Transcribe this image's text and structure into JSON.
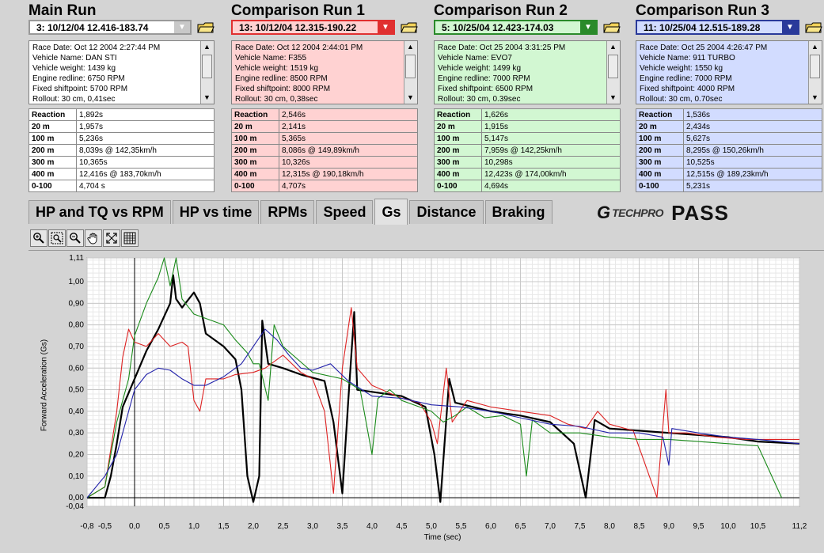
{
  "runs": [
    {
      "title": "Main Run",
      "selector": "3:  10/12/04 12.416-183.74",
      "color": "#ffffff",
      "btn": "#c8c8c8",
      "info": [
        "Race Date: Oct 12 2004  2:27:44 PM",
        "Vehicle Name: DAN STI",
        "Vehicle weight: 1439 kg",
        "Engine redline: 6750 RPM",
        "Fixed shiftpoint: 5700 RPM",
        "Rollout: 30 cm, 0,41sec"
      ],
      "stats": [
        [
          "Reaction",
          "1,892s"
        ],
        [
          "20 m",
          "1,957s"
        ],
        [
          "100 m",
          "5,236s"
        ],
        [
          "200 m",
          "8,039s @ 142,35km/h"
        ],
        [
          "300 m",
          "10,365s"
        ],
        [
          "400 m",
          "12,416s @ 183,70km/h"
        ],
        [
          "0-100",
          "4,704 s"
        ]
      ]
    },
    {
      "title": "Comparison Run 1",
      "selector": "13:  10/12/04 12.315-190.22",
      "color": "#ffd2d2",
      "btn": "#e03030",
      "info": [
        "Race Date: Oct 12 2004  2:44:01 PM",
        "Vehicle Name: F355",
        "Vehicle weight: 1519 kg",
        "Engine redline: 8500 RPM",
        "Fixed shiftpoint: 8000 RPM",
        "Rollout: 30 cm, 0,38sec"
      ],
      "stats": [
        [
          "Reaction",
          "2,546s"
        ],
        [
          "20 m",
          "2,141s"
        ],
        [
          "100 m",
          "5,365s"
        ],
        [
          "200 m",
          "8,086s @ 149,89km/h"
        ],
        [
          "300 m",
          "10,326s"
        ],
        [
          "400 m",
          "12,315s @ 190,18km/h"
        ],
        [
          "0-100",
          "4,707s"
        ]
      ]
    },
    {
      "title": "Comparison Run 2",
      "selector": "5:  10/25/04 12.423-174.03",
      "color": "#d2f7d2",
      "btn": "#2a8a2a",
      "info": [
        "Race Date: Oct 25 2004  3:31:25 PM",
        "Vehicle Name: EVO7",
        "Vehicle weight: 1499 kg",
        "Engine redline: 7000 RPM",
        "Fixed shiftpoint: 6500 RPM",
        "Rollout: 30 cm, 0.39sec"
      ],
      "stats": [
        [
          "Reaction",
          "1,626s"
        ],
        [
          "20 m",
          "1,915s"
        ],
        [
          "100 m",
          "5,147s"
        ],
        [
          "200 m",
          "7,959s @ 142,25km/h"
        ],
        [
          "300 m",
          "10,298s"
        ],
        [
          "400 m",
          "12,423s @ 174,00km/h"
        ],
        [
          "0-100",
          "4,694s"
        ]
      ]
    },
    {
      "title": "Comparison Run 3",
      "selector": "11:  10/25/04 12.515-189.28",
      "color": "#d2dcff",
      "btn": "#2a3a9a",
      "info": [
        "Race Date: Oct 25 2004  4:26:47 PM",
        "Vehicle Name: 911 TURBO",
        "Vehicle weight: 1550 kg",
        "Engine redline: 7000 RPM",
        "Fixed shiftpoint: 4000 RPM",
        "Rollout: 30 cm, 0.70sec"
      ],
      "stats": [
        [
          "Reaction",
          "1,536s"
        ],
        [
          "20 m",
          "2,434s"
        ],
        [
          "100 m",
          "5,627s"
        ],
        [
          "200 m",
          "8,295s @ 150,26km/h"
        ],
        [
          "300 m",
          "10,525s"
        ],
        [
          "400 m",
          "12,515s @ 189,23km/h"
        ],
        [
          "0-100",
          "5,231s"
        ]
      ]
    }
  ],
  "tabs": [
    "HP and TQ vs RPM",
    "HP vs time",
    "RPMs",
    "Speed",
    "Gs",
    "Distance",
    "Braking"
  ],
  "active_tab": "Gs",
  "logo": {
    "g": "G",
    "tech": "TECHPRO",
    "pass": "PASS"
  },
  "tools": [
    "zoom-in-icon",
    "zoom-box-icon",
    "zoom-out-icon",
    "pan-hand-icon",
    "fit-icon",
    "grid-icon"
  ],
  "chart": {
    "ylabel": "Forward Acceleration (Gs)",
    "xlabel": "Time (sec)",
    "xlim": [
      -0.8,
      11.2
    ],
    "ylim": [
      -0.04,
      1.11
    ],
    "xticks": [
      "-0,8",
      "-0,5",
      "0,0",
      "0,5",
      "1,0",
      "1,5",
      "2,0",
      "2,5",
      "3,0",
      "3,5",
      "4,0",
      "4,5",
      "5,0",
      "5,5",
      "6,0",
      "6,5",
      "7,0",
      "7,5",
      "8,0",
      "8,5",
      "9,0",
      "9,5",
      "10,0",
      "10,5",
      "11,2"
    ],
    "xtick_vals": [
      -0.8,
      -0.5,
      0,
      0.5,
      1,
      1.5,
      2,
      2.5,
      3,
      3.5,
      4,
      4.5,
      5,
      5.5,
      6,
      6.5,
      7,
      7.5,
      8,
      8.5,
      9,
      9.5,
      10,
      10.5,
      11.2
    ],
    "yticks": [
      "-0,04",
      "0,00",
      "0,10",
      "0,20",
      "0,30",
      "0,40",
      "0,50",
      "0,60",
      "0,70",
      "0,80",
      "0,90",
      "1,00",
      "1,11"
    ],
    "ytick_vals": [
      -0.04,
      0,
      0.1,
      0.2,
      0.3,
      0.4,
      0.5,
      0.6,
      0.7,
      0.8,
      0.9,
      1.0,
      1.11
    ]
  },
  "chart_data": {
    "type": "line",
    "x_unit": "sec",
    "y_unit": "Gs",
    "series": [
      {
        "name": "Main Run",
        "color": "#000000",
        "points": [
          [
            -0.8,
            0
          ],
          [
            -0.5,
            0
          ],
          [
            -0.4,
            0.1
          ],
          [
            -0.3,
            0.25
          ],
          [
            -0.2,
            0.42
          ],
          [
            0,
            0.55
          ],
          [
            0.2,
            0.68
          ],
          [
            0.4,
            0.78
          ],
          [
            0.6,
            0.9
          ],
          [
            0.65,
            1.03
          ],
          [
            0.7,
            0.92
          ],
          [
            0.8,
            0.88
          ],
          [
            1.0,
            0.95
          ],
          [
            1.1,
            0.9
          ],
          [
            1.2,
            0.76
          ],
          [
            1.5,
            0.7
          ],
          [
            1.7,
            0.64
          ],
          [
            1.8,
            0.5
          ],
          [
            1.9,
            0.1
          ],
          [
            2.0,
            -0.02
          ],
          [
            2.1,
            0.1
          ],
          [
            2.15,
            0.82
          ],
          [
            2.25,
            0.62
          ],
          [
            2.5,
            0.6
          ],
          [
            2.8,
            0.57
          ],
          [
            3.2,
            0.54
          ],
          [
            3.35,
            0.35
          ],
          [
            3.5,
            0.02
          ],
          [
            3.6,
            0.45
          ],
          [
            3.7,
            0.86
          ],
          [
            3.75,
            0.5
          ],
          [
            4.0,
            0.49
          ],
          [
            4.5,
            0.47
          ],
          [
            4.9,
            0.42
          ],
          [
            5.05,
            0.2
          ],
          [
            5.15,
            -0.02
          ],
          [
            5.3,
            0.55
          ],
          [
            5.4,
            0.44
          ],
          [
            6.0,
            0.4
          ],
          [
            6.5,
            0.38
          ],
          [
            7.0,
            0.35
          ],
          [
            7.4,
            0.25
          ],
          [
            7.6,
            0.0
          ],
          [
            7.75,
            0.36
          ],
          [
            8.0,
            0.32
          ],
          [
            8.5,
            0.31
          ],
          [
            9.0,
            0.3
          ],
          [
            9.5,
            0.29
          ],
          [
            10.0,
            0.28
          ],
          [
            10.5,
            0.26
          ],
          [
            11.2,
            0.25
          ]
        ]
      },
      {
        "name": "Comparison Run 1",
        "color": "#dd2222",
        "points": [
          [
            -0.8,
            0
          ],
          [
            -0.5,
            0.05
          ],
          [
            -0.3,
            0.4
          ],
          [
            -0.2,
            0.65
          ],
          [
            -0.1,
            0.78
          ],
          [
            0,
            0.72
          ],
          [
            0.2,
            0.7
          ],
          [
            0.4,
            0.76
          ],
          [
            0.6,
            0.7
          ],
          [
            0.8,
            0.72
          ],
          [
            0.9,
            0.7
          ],
          [
            1.0,
            0.45
          ],
          [
            1.1,
            0.4
          ],
          [
            1.2,
            0.55
          ],
          [
            1.5,
            0.55
          ],
          [
            1.7,
            0.57
          ],
          [
            2.0,
            0.58
          ],
          [
            2.2,
            0.6
          ],
          [
            2.5,
            0.66
          ],
          [
            2.8,
            0.58
          ],
          [
            3.0,
            0.55
          ],
          [
            3.2,
            0.4
          ],
          [
            3.35,
            0.02
          ],
          [
            3.5,
            0.6
          ],
          [
            3.65,
            0.88
          ],
          [
            3.75,
            0.6
          ],
          [
            4.0,
            0.52
          ],
          [
            4.5,
            0.46
          ],
          [
            4.8,
            0.44
          ],
          [
            5.0,
            0.35
          ],
          [
            5.1,
            0.25
          ],
          [
            5.25,
            0.6
          ],
          [
            5.35,
            0.35
          ],
          [
            5.6,
            0.45
          ],
          [
            6.0,
            0.42
          ],
          [
            6.5,
            0.4
          ],
          [
            7.0,
            0.38
          ],
          [
            7.3,
            0.34
          ],
          [
            7.6,
            0.32
          ],
          [
            7.8,
            0.4
          ],
          [
            8.0,
            0.34
          ],
          [
            8.4,
            0.31
          ],
          [
            8.8,
            0.0
          ],
          [
            8.95,
            0.5
          ],
          [
            9.0,
            0.3
          ],
          [
            9.3,
            0.3
          ],
          [
            9.8,
            0.28
          ],
          [
            10.3,
            0.27
          ],
          [
            11.2,
            0.27
          ]
        ]
      },
      {
        "name": "Comparison Run 2",
        "color": "#1a8a1a",
        "points": [
          [
            -0.8,
            0
          ],
          [
            -0.5,
            0.05
          ],
          [
            -0.3,
            0.35
          ],
          [
            -0.1,
            0.55
          ],
          [
            0,
            0.75
          ],
          [
            0.2,
            0.9
          ],
          [
            0.4,
            1.02
          ],
          [
            0.5,
            1.11
          ],
          [
            0.6,
            0.98
          ],
          [
            0.7,
            1.11
          ],
          [
            0.8,
            0.92
          ],
          [
            1.0,
            0.85
          ],
          [
            1.2,
            0.83
          ],
          [
            1.5,
            0.8
          ],
          [
            1.7,
            0.73
          ],
          [
            1.9,
            0.67
          ],
          [
            2.0,
            0.62
          ],
          [
            2.1,
            0.62
          ],
          [
            2.25,
            0.45
          ],
          [
            2.35,
            0.8
          ],
          [
            2.5,
            0.7
          ],
          [
            3.0,
            0.58
          ],
          [
            3.5,
            0.55
          ],
          [
            3.8,
            0.5
          ],
          [
            4.0,
            0.2
          ],
          [
            4.1,
            0.46
          ],
          [
            4.3,
            0.5
          ],
          [
            4.5,
            0.45
          ],
          [
            4.8,
            0.42
          ],
          [
            5.0,
            0.4
          ],
          [
            5.2,
            0.35
          ],
          [
            5.4,
            0.38
          ],
          [
            5.6,
            0.42
          ],
          [
            5.9,
            0.37
          ],
          [
            6.2,
            0.38
          ],
          [
            6.5,
            0.34
          ],
          [
            6.6,
            0.1
          ],
          [
            6.7,
            0.36
          ],
          [
            7.0,
            0.3
          ],
          [
            7.5,
            0.3
          ],
          [
            8.0,
            0.28
          ],
          [
            8.5,
            0.27
          ],
          [
            9.0,
            0.27
          ],
          [
            9.5,
            0.26
          ],
          [
            10.0,
            0.25
          ],
          [
            10.5,
            0.24
          ],
          [
            10.9,
            0.0
          ]
        ]
      },
      {
        "name": "Comparison Run 3",
        "color": "#2222aa",
        "points": [
          [
            -0.8,
            0
          ],
          [
            -0.5,
            0.1
          ],
          [
            -0.3,
            0.2
          ],
          [
            -0.1,
            0.4
          ],
          [
            0,
            0.5
          ],
          [
            0.2,
            0.57
          ],
          [
            0.4,
            0.6
          ],
          [
            0.6,
            0.59
          ],
          [
            0.8,
            0.55
          ],
          [
            1.0,
            0.52
          ],
          [
            1.2,
            0.52
          ],
          [
            1.5,
            0.56
          ],
          [
            1.8,
            0.62
          ],
          [
            2.0,
            0.7
          ],
          [
            2.2,
            0.78
          ],
          [
            2.4,
            0.73
          ],
          [
            2.6,
            0.66
          ],
          [
            2.8,
            0.6
          ],
          [
            3.0,
            0.59
          ],
          [
            3.3,
            0.62
          ],
          [
            3.6,
            0.54
          ],
          [
            4.0,
            0.47
          ],
          [
            4.5,
            0.46
          ],
          [
            5.0,
            0.43
          ],
          [
            5.5,
            0.42
          ],
          [
            6.0,
            0.4
          ],
          [
            6.5,
            0.37
          ],
          [
            7.0,
            0.34
          ],
          [
            7.5,
            0.33
          ],
          [
            8.0,
            0.3
          ],
          [
            8.5,
            0.3
          ],
          [
            8.9,
            0.28
          ],
          [
            9.0,
            0.15
          ],
          [
            9.05,
            0.32
          ],
          [
            9.5,
            0.3
          ],
          [
            10.0,
            0.28
          ],
          [
            10.5,
            0.27
          ],
          [
            11.2,
            0.25
          ]
        ]
      }
    ]
  }
}
